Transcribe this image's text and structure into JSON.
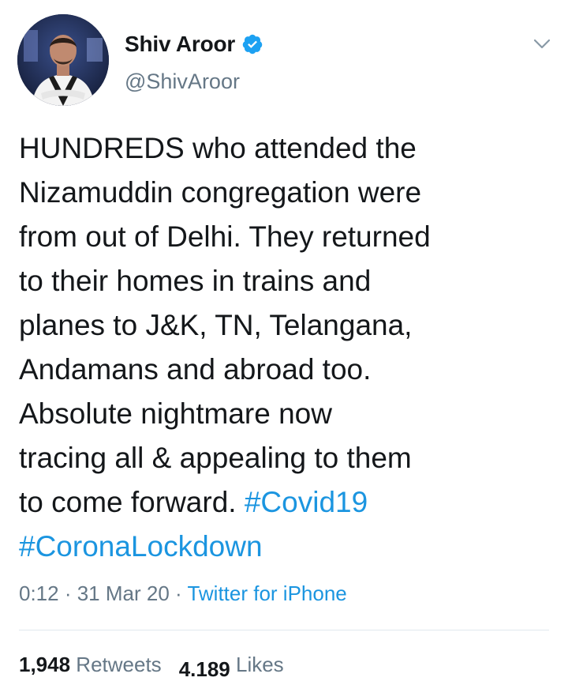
{
  "author": {
    "display_name": "Shiv Aroor",
    "handle": "@ShivAroor",
    "verified": true
  },
  "tweet": {
    "lines": [
      "HUNDREDS who attended the",
      "Nizamuddin congregation were",
      "from out of Delhi. They returned",
      "to their homes in trains and",
      "planes to J&K, TN, Telangana,",
      "Andamans and abroad too.",
      "Absolute nightmare now",
      "tracing all & appealing to them",
      "to come forward. "
    ],
    "hashtag_1": "#Covid19",
    "hashtag_2": "#CoronaLockdown"
  },
  "meta": {
    "time": "0:12",
    "separator": " · ",
    "date": "31 Mar 20",
    "source": "Twitter for iPhone"
  },
  "stats": {
    "retweets_count": "1,948",
    "retweets_label": " Retweets",
    "likes_count": "4.189",
    "likes_label": " Likes"
  },
  "icons": {
    "verified": "verified-badge-icon",
    "menu": "chevron-down-icon"
  },
  "colors": {
    "text": "#14171a",
    "secondary": "#657786",
    "link": "#1b95e0",
    "divider": "#e1e8ed"
  }
}
